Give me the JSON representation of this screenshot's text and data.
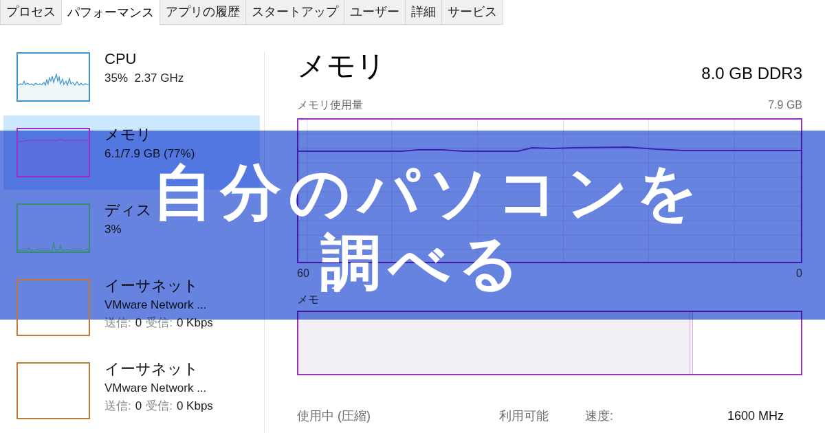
{
  "tabs": [
    {
      "label": "プロセス",
      "selected": false
    },
    {
      "label": "パフォーマンス",
      "selected": true
    },
    {
      "label": "アプリの履歴",
      "selected": false
    },
    {
      "label": "スタートアップ",
      "selected": false
    },
    {
      "label": "ユーザー",
      "selected": false
    },
    {
      "label": "詳細",
      "selected": false
    },
    {
      "label": "サービス",
      "selected": false
    }
  ],
  "sidebar": {
    "items": [
      {
        "kind": "cpu",
        "selected": false,
        "color": "#3c96cc",
        "title": "CPU",
        "subtitle": "35%  2.37 GHz"
      },
      {
        "kind": "memory",
        "selected": true,
        "color": "#9b2fc0",
        "title": "メモリ",
        "subtitle": "6.1/7.9 GB (77%)"
      },
      {
        "kind": "disk",
        "selected": false,
        "color": "#3a8a72",
        "title": "ディス",
        "subtitle": "3%"
      },
      {
        "kind": "network",
        "selected": false,
        "color": "#c07a35",
        "title": "イーサネット",
        "subtitle": "VMware Network ...",
        "send_label": "送信:",
        "send_value": "0",
        "receive_label": "受信:",
        "receive_value": "0 Kbps"
      },
      {
        "kind": "network",
        "selected": false,
        "color": "#c07a35",
        "title": "イーサネット",
        "subtitle": "VMware Network ...",
        "send_label": "送信:",
        "send_value": "0",
        "receive_label": "受信:",
        "receive_value": "0 Kbps"
      }
    ]
  },
  "detail": {
    "title": "メモリ",
    "capacity": "8.0 GB DDR3",
    "usage_graph": {
      "label": "メモリ使用量",
      "max": "7.9 GB",
      "time_start": "60",
      "time_end": "0"
    },
    "composition": {
      "label": "メモ",
      "level": 0.78
    },
    "stats": [
      {
        "label": "使用中 (圧縮)"
      },
      {
        "label": "利用可能"
      },
      {
        "label": "速度:",
        "value": "1600 MHz"
      }
    ]
  },
  "banner": {
    "headline_lines": [
      "自分のパソコンを",
      "調べる"
    ]
  }
}
